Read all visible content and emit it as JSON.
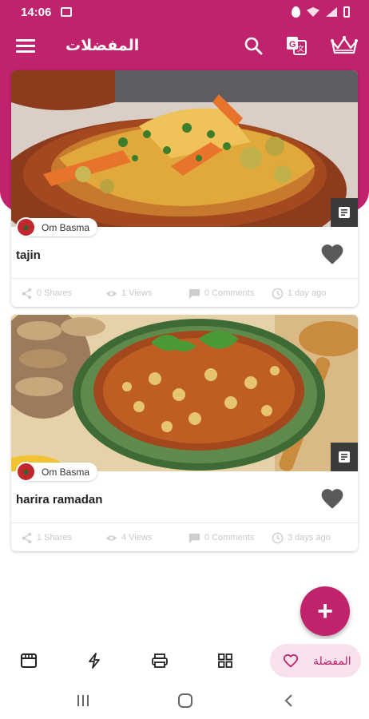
{
  "status_bar": {
    "time": "14:06"
  },
  "app_bar": {
    "title": "المفضلات"
  },
  "posts": [
    {
      "author": "Om Basma",
      "title": "tajin",
      "shares": "0 Shares",
      "views": "1 Views",
      "comments": "0 Comments",
      "time_ago": "1 day ago"
    },
    {
      "author": "Om Basma",
      "title": "harira ramadan",
      "shares": "1 Shares",
      "views": "4 Views",
      "comments": "0 Comments",
      "time_ago": "3 days ago"
    }
  ],
  "fab": {
    "label": "+"
  },
  "bottom_nav": {
    "favorites_label": "المفضلة"
  },
  "colors": {
    "primary": "#c0226b",
    "active_pill": "#f8e1ec"
  },
  "icons": [
    "menu-icon",
    "search-icon",
    "translate-icon",
    "crown-icon",
    "share-icon",
    "eye-icon",
    "comment-icon",
    "clock-icon",
    "heart-icon",
    "article-icon",
    "store-icon",
    "flash-icon",
    "printer-icon",
    "grid-icon"
  ]
}
